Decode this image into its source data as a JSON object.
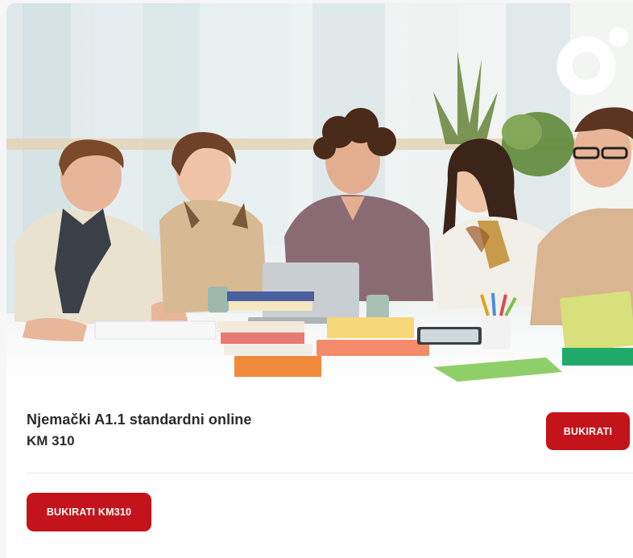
{
  "course": {
    "title": "Njemački A1.1 standardni online",
    "price": "KM 310"
  },
  "buttons": {
    "book_label": "BUKIRATI",
    "book_price_label": "BUKIRATI KM310"
  },
  "hero": {
    "image_alt": "Students studying together at a table",
    "logo_icon": "circle-dot-logo-icon"
  },
  "colors": {
    "accent_red": "#c3141c",
    "title_text": "#2b2b2b",
    "divider": "#e6e6e6"
  }
}
